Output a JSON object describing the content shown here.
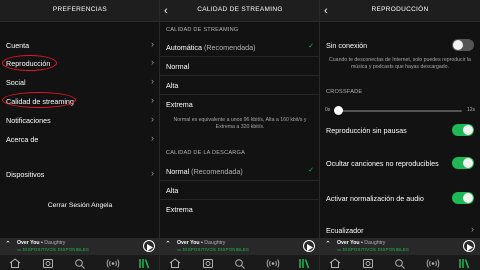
{
  "panel1": {
    "title": "PREFERENCIAS",
    "items": [
      {
        "label": "Cuenta"
      },
      {
        "label": "Reproducción"
      },
      {
        "label": "Social"
      },
      {
        "label": "Calidad de streaming"
      },
      {
        "label": "Notificaciones"
      },
      {
        "label": "Acerca de"
      },
      {
        "label": "Dispositivos"
      }
    ],
    "logout": "Cerrar Sesión Angela"
  },
  "panel2": {
    "title": "CALIDAD DE STREAMING",
    "streaming_section": "CALIDAD DE STREAMING",
    "streaming_options": [
      {
        "label": "Automática",
        "note": "(Recomendada)",
        "selected": true
      },
      {
        "label": "Normal",
        "selected": false
      },
      {
        "label": "Alta",
        "selected": false
      },
      {
        "label": "Extrema",
        "selected": false
      }
    ],
    "note": "Normal es equivalente a unos 96 kbit/s, Alta a 160 kbit/s y Extrema a 320 kbit/s.",
    "download_section": "CALIDAD DE LA DESCARGA",
    "download_options": [
      {
        "label": "Normal",
        "note": "(Recomendada)",
        "selected": true
      },
      {
        "label": "Alta",
        "selected": false
      },
      {
        "label": "Extrema",
        "selected": false
      }
    ]
  },
  "panel3": {
    "title": "REPRODUCCIÓN",
    "offline_label": "Sin conexión",
    "offline_on": false,
    "offline_note": "Cuando te desconectas de Internet, solo puedes reproducir la música y podcasts que hayas descargado.",
    "crossfade_section": "CROSSFADE",
    "crossfade_min": "0s",
    "crossfade_max": "12s",
    "crossfade_value": 0,
    "gapless_label": "Reproducción sin pausas",
    "gapless_on": true,
    "hide_unplayable_label": "Ocultar canciones no reproducibles",
    "hide_unplayable_on": true,
    "normalize_label": "Activar normalización de audio",
    "normalize_on": true,
    "equalizer_label": "Ecualizador"
  },
  "player": {
    "song": "Over You",
    "separator": " • ",
    "artist": "Daughtry",
    "devices": "DISPOSITIVOS DISPONIBLES"
  },
  "icons": [
    "back-icon",
    "chevron-right-icon",
    "check-icon",
    "chevron-up-icon",
    "play-icon",
    "home-icon",
    "browse-icon",
    "search-icon",
    "radio-icon",
    "library-icon",
    "devices-icon"
  ],
  "colors": {
    "accent": "#1db954",
    "highlight": "#e0162b",
    "background": "#121212"
  }
}
